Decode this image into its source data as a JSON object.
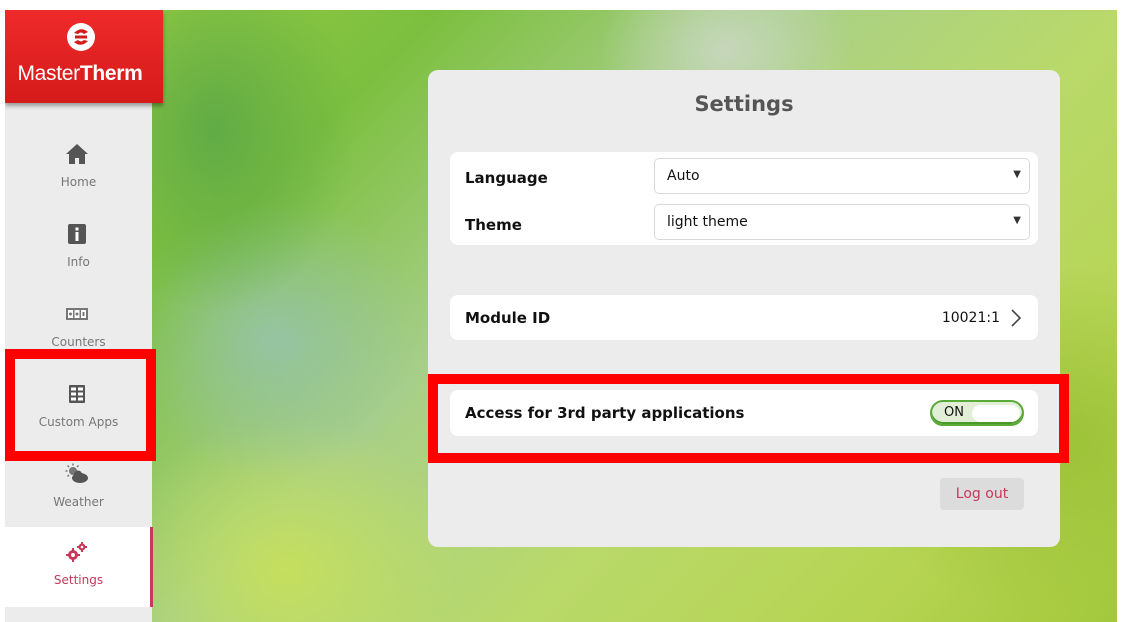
{
  "brand": {
    "logo_light": "Master",
    "logo_bold": "Therm"
  },
  "nav": {
    "home": "Home",
    "info": "Info",
    "counters": "Counters",
    "custom_apps": "Custom Apps",
    "weather": "Weather",
    "settings": "Settings"
  },
  "settings": {
    "title": "Settings",
    "language_label": "Language",
    "language_value": "Auto",
    "theme_label": "Theme",
    "theme_value": "light theme",
    "module_id_label": "Module ID",
    "module_id_value": "10021:1",
    "third_party_label": "Access for 3rd party applications",
    "third_party_toggle": "ON",
    "logout_label": "Log out"
  },
  "colors": {
    "brand_red": "#e02020",
    "accent": "#c8385a",
    "toggle_green": "#5aaa3a",
    "highlight": "#ff0000"
  },
  "icons": [
    "home-icon",
    "info-icon",
    "counters-icon",
    "custom-apps-icon",
    "weather-icon",
    "settings-gears-icon",
    "chevron-down-icon",
    "chevron-right-icon"
  ]
}
